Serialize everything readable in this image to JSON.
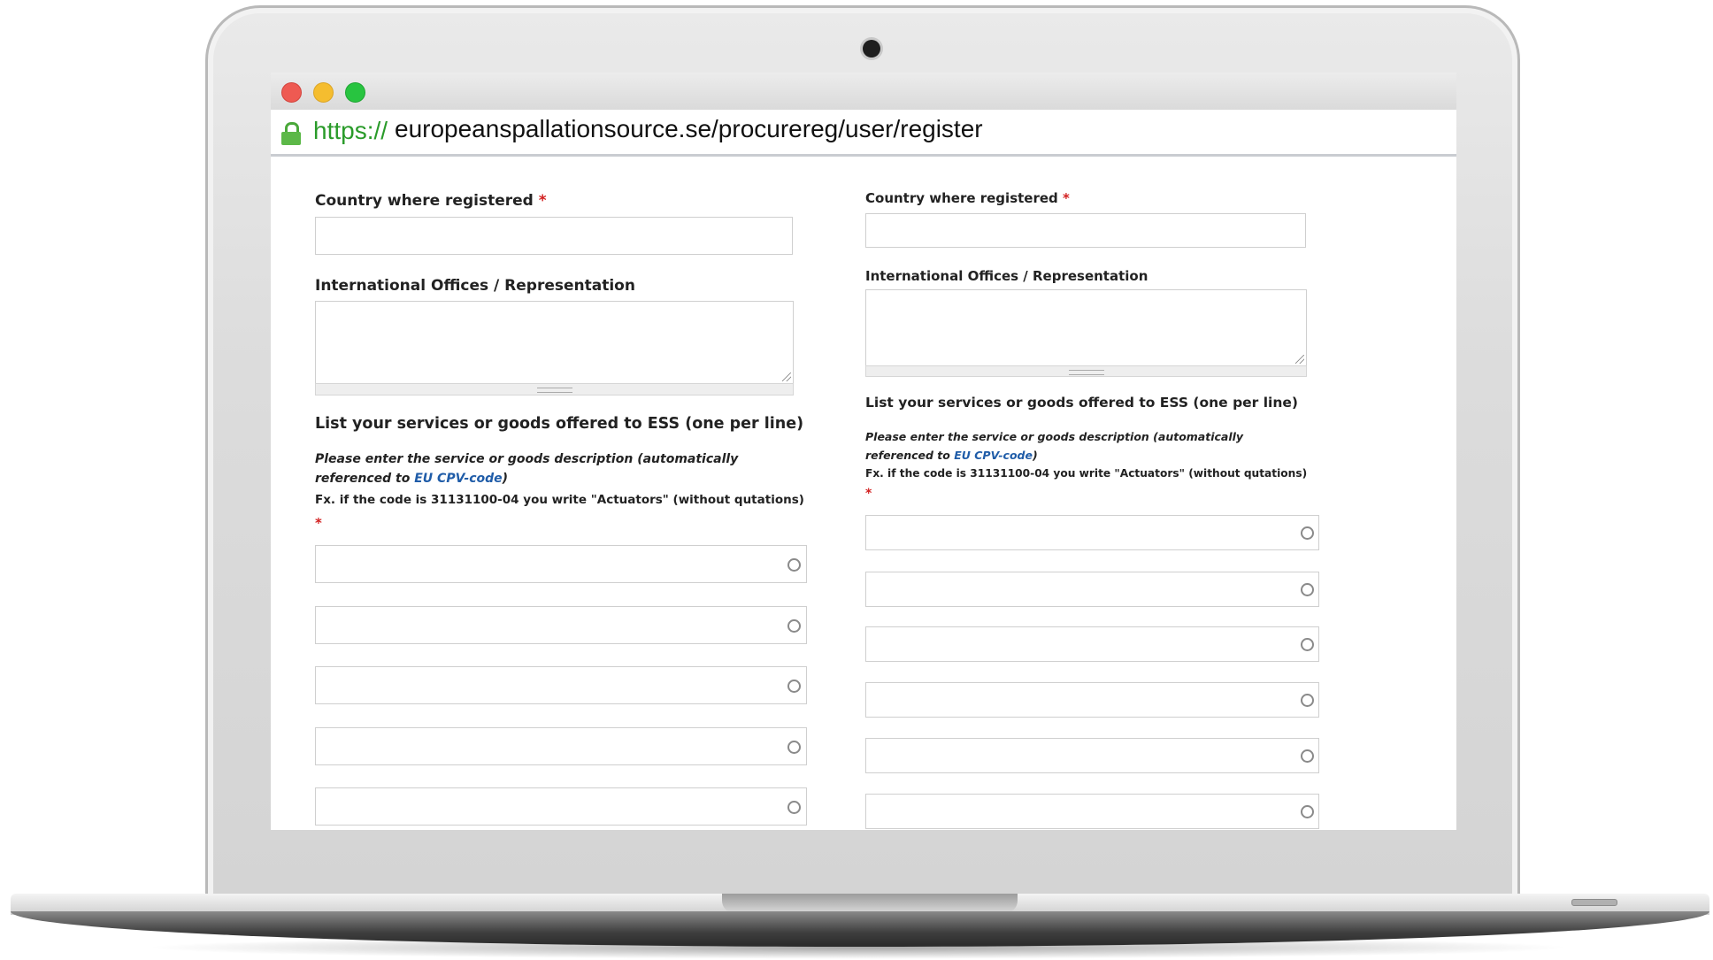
{
  "browser": {
    "url_scheme": "https://",
    "url_rest": "europeanspallationsource.se/procurereg/user/register"
  },
  "form": {
    "country_label": "Country where registered",
    "required_marker": "*",
    "offices_label": "International Offices / Representation",
    "services_heading": "List your services or goods offered to ESS (one per line)",
    "services_help_text": "Please enter the service or goods description (automatically referenced to ",
    "services_help_link": "EU CPV-code",
    "services_help_close": ")",
    "services_example": "Fx. if the code is 31131100-04 you write \"Actuators\" (without qutations)",
    "service_fields_left": [
      "",
      "",
      "",
      "",
      ""
    ],
    "service_fields_right": [
      "",
      "",
      "",
      "",
      "",
      ""
    ]
  },
  "colors": {
    "required": "#d21f1f",
    "link": "#1f5ca8",
    "secure_scheme": "#2a9b2a"
  }
}
